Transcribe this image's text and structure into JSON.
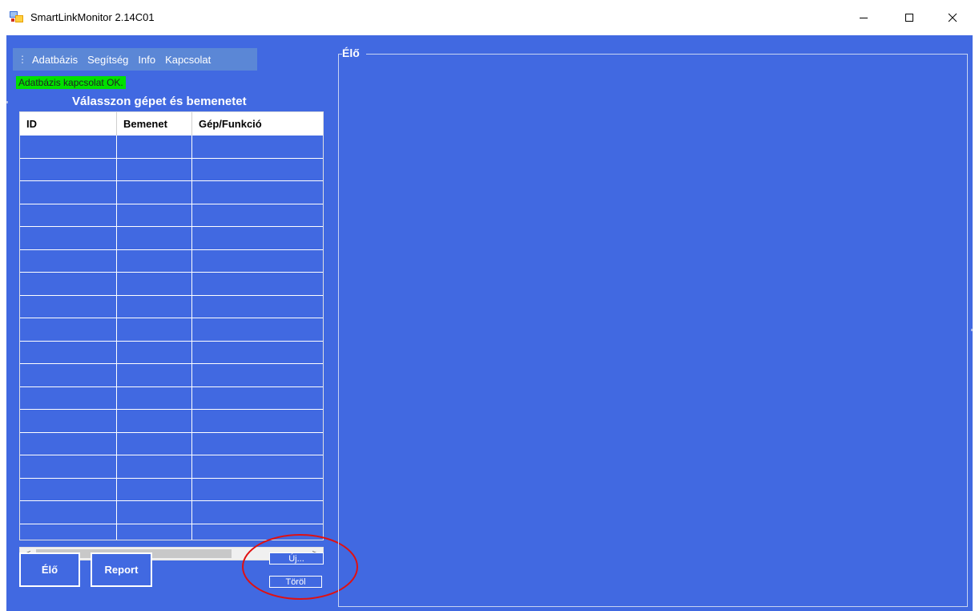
{
  "window": {
    "title": "SmartLinkMonitor 2.14C01",
    "icon": "app-window-icon",
    "controls": {
      "minimize": "minimize-icon",
      "maximize": "maximize-icon",
      "close": "close-icon"
    }
  },
  "colors": {
    "background": "#4169E1",
    "status_ok": "#00E000",
    "menubar": "#5B87D6",
    "highlight": "#E01010"
  },
  "menu": {
    "grip": "⋮",
    "items": [
      {
        "label": "Adatbázis"
      },
      {
        "label": "Segítség"
      },
      {
        "label": "Info"
      },
      {
        "label": "Kapcsolat"
      }
    ]
  },
  "status": {
    "text": "Adatbázis kapcsolat OK."
  },
  "list": {
    "title": "Válasszon gépet és bemenetet",
    "columns": [
      "ID",
      "Bemenet",
      "Gép/Funkció"
    ],
    "rows": []
  },
  "scrollbar": {
    "left_arrow": "<",
    "right_arrow": ">"
  },
  "buttons": {
    "elo": "Élő",
    "report": "Report",
    "uj": "Új...",
    "torol": "Töröl"
  },
  "panel": {
    "label": "Élő"
  }
}
